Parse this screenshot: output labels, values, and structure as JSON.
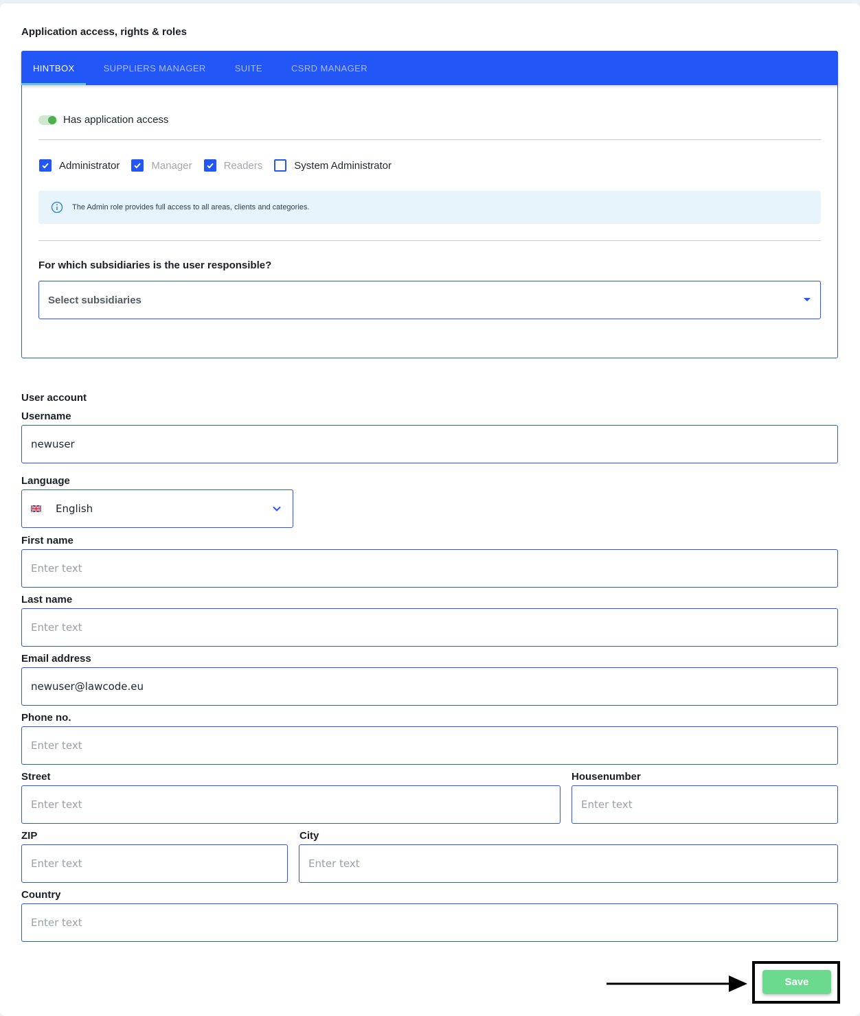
{
  "section": {
    "title": "Application access, rights & roles"
  },
  "tabs": [
    {
      "label": "HINTBOX",
      "active": true
    },
    {
      "label": "SUPPLIERS MANAGER",
      "active": false
    },
    {
      "label": "SUITE",
      "active": false
    },
    {
      "label": "CSRD MANAGER",
      "active": false
    }
  ],
  "access": {
    "toggle_label": "Has application access",
    "enabled": true
  },
  "roles": [
    {
      "label": "Administrator",
      "checked": true,
      "muted": false
    },
    {
      "label": "Manager",
      "checked": true,
      "muted": true
    },
    {
      "label": "Readers",
      "checked": true,
      "muted": true
    },
    {
      "label": "System Administrator",
      "checked": false,
      "muted": false
    }
  ],
  "info": {
    "text": "The Admin role provides full access to all areas, clients and categories."
  },
  "subsidiaries": {
    "question": "For which subsidiaries is the user responsible?",
    "placeholder": "Select subsidiaries"
  },
  "user_account": {
    "title": "User account",
    "username": {
      "label": "Username",
      "value": "newuser"
    },
    "language": {
      "label": "Language",
      "value": "English"
    },
    "first_name": {
      "label": "First name",
      "placeholder": "Enter text"
    },
    "last_name": {
      "label": "Last name",
      "placeholder": "Enter text"
    },
    "email": {
      "label": "Email address",
      "value": "newuser@lawcode.eu"
    },
    "phone": {
      "label": "Phone no.",
      "placeholder": "Enter text"
    },
    "street": {
      "label": "Street",
      "placeholder": "Enter text"
    },
    "housenumber": {
      "label": "Housenumber",
      "placeholder": "Enter text"
    },
    "zip": {
      "label": "ZIP",
      "placeholder": "Enter text"
    },
    "city": {
      "label": "City",
      "placeholder": "Enter text"
    },
    "country": {
      "label": "Country",
      "placeholder": "Enter text"
    }
  },
  "actions": {
    "save_label": "Save"
  },
  "colors": {
    "primary": "#2356f6",
    "save": "#6bd98e",
    "toggle_on": "#4caf50",
    "info_bg": "#e8f4fb"
  },
  "icons": {
    "info": "info-circle-icon",
    "dropdown": "caret-down-icon",
    "language_flag": "uk-flag-icon",
    "language_chevron": "chevron-down-icon",
    "annotation": "arrow-right-icon"
  }
}
